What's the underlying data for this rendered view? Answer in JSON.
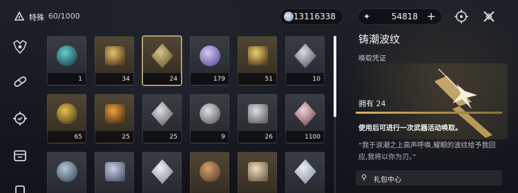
{
  "header": {
    "category_name": "特殊",
    "category_count": "60/1000",
    "currency_1": {
      "icon": "coin-icon",
      "value": "13116338"
    },
    "currency_2": {
      "icon": "star-shard-icon",
      "value": "54818",
      "add_label": "+"
    }
  },
  "nav": [
    "emblem-icon",
    "capsule-icon",
    "gear-badge-icon",
    "cube-icon",
    "tag-icon"
  ],
  "grid": {
    "items": [
      {
        "name": "teal-orb-item",
        "count": "1",
        "rare": false,
        "selected": false
      },
      {
        "name": "gold-compass-item",
        "count": "34",
        "rare": true,
        "selected": false
      },
      {
        "name": "tide-ripple-item",
        "count": "24",
        "rare": true,
        "selected": true
      },
      {
        "name": "coral-crystal-item",
        "count": "179",
        "rare": false,
        "selected": false
      },
      {
        "name": "gold-chest-item",
        "count": "51",
        "rare": true,
        "selected": false
      },
      {
        "name": "silver-chest-item",
        "count": "10",
        "rare": false,
        "selected": false
      },
      {
        "name": "gold-capsule-item",
        "count": "65",
        "rare": true,
        "selected": false
      },
      {
        "name": "lantern-cage-item",
        "count": "25",
        "rare": true,
        "selected": false
      },
      {
        "name": "echo-frame-item-a",
        "count": "25",
        "rare": false,
        "selected": false
      },
      {
        "name": "echo-frame-item-b",
        "count": "9",
        "rare": false,
        "selected": false
      },
      {
        "name": "echo-frame-item-c",
        "count": "26",
        "rare": false,
        "selected": false
      },
      {
        "name": "perfume-jar-item",
        "count": "1100",
        "rare": false,
        "selected": false
      },
      {
        "name": "photo-stack-item",
        "count": "",
        "rare": false,
        "selected": false
      },
      {
        "name": "feather-quill-item",
        "count": "",
        "rare": false,
        "selected": false
      },
      {
        "name": "paper-crane-item",
        "count": "",
        "rare": false,
        "selected": false
      },
      {
        "name": "layer-cake-item",
        "count": "",
        "rare": true,
        "selected": false
      },
      {
        "name": "cream-cake-item",
        "count": "",
        "rare": true,
        "selected": false
      },
      {
        "name": "seal-plush-item",
        "count": "",
        "rare": false,
        "selected": false
      }
    ]
  },
  "detail": {
    "title": "铸潮波纹",
    "subtitle": "唤取凭证",
    "owned_label": "拥有 24",
    "description": "使用后可进行一次武器活动唤取。",
    "quote": "“我于浪潮之上高声呼唤,耀眼的波纹给予我回应,我将以你为刃。”",
    "source_label": "礼包中心"
  },
  "colors": {
    "accent_gold": "#d9c48a",
    "rare_slot": "#514634",
    "common_slot": "#3a3d44"
  }
}
